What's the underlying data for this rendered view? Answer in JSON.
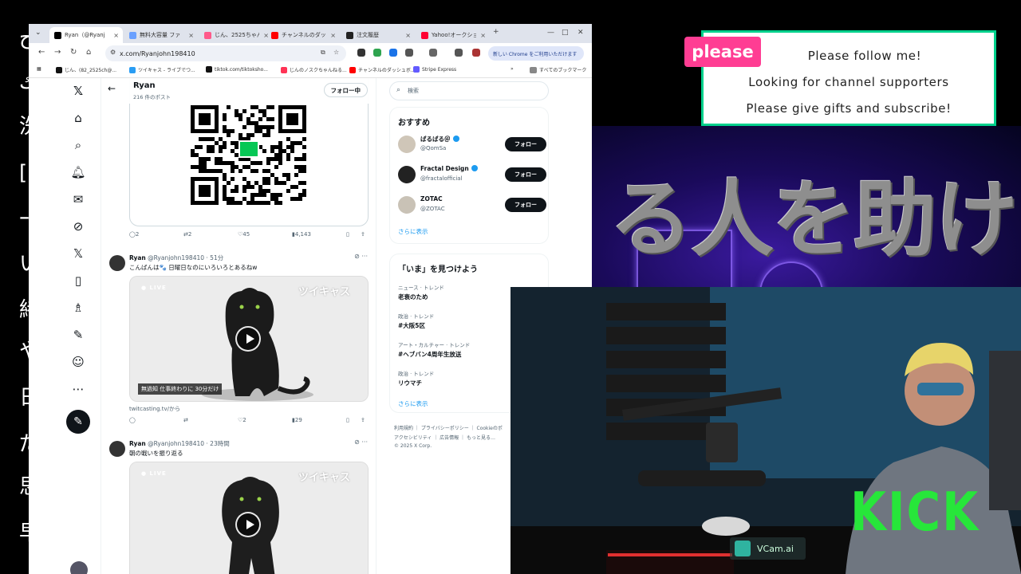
{
  "left_strip": {
    "glyphs": [
      "ح",
      "ك",
      "洗",
      "[",
      "ｰ",
      "い",
      "緒",
      "や",
      "日",
      "だ",
      "思",
      "早"
    ]
  },
  "browser": {
    "tabs": [
      {
        "label": "Ryan（@Ryanj",
        "color": "#000000",
        "active": true
      },
      {
        "label": "無料大容量 ファ",
        "color": "#6aa0ff",
        "active": false
      },
      {
        "label": "じん、2525ちゃん",
        "color": "#ff5a8a",
        "active": false
      },
      {
        "label": "チャンネルのダッシ",
        "color": "#ff0000",
        "active": false
      },
      {
        "label": "注文履歴",
        "color": "#222222",
        "active": false
      },
      {
        "label": "Yahoo!オークショ",
        "color": "#ff0033",
        "active": false
      }
    ],
    "new_tab": "+",
    "window_controls": [
      "—",
      "□",
      "✕"
    ],
    "url": "x.com/Ryanjohn198410",
    "chrome_promo": "新しい Chrome をご利用いただけます",
    "bookmarks": [
      {
        "label": "じん、(82_2525ch@...",
        "color": "#111111"
      },
      {
        "label": "ツイキャス - ライブでつ...",
        "color": "#2a9df4"
      },
      {
        "label": "tiktok.com/tiktoksho...",
        "color": "#111111"
      },
      {
        "label": "じんのノスクちゃんねる...",
        "color": "#ff3355"
      },
      {
        "label": "チャンネルのダッシュボ...",
        "color": "#ff0000"
      },
      {
        "label": "Stripe Express",
        "color": "#635bff"
      }
    ],
    "all_bookmarks": "すべてのブックマーク"
  },
  "profile": {
    "name": "Ryan",
    "post_count": "216 件のポスト",
    "follow_label": "フォロー中"
  },
  "posts": [
    {
      "actions": {
        "reply": "2",
        "repost": "2",
        "like": "45",
        "views": "4,143"
      }
    },
    {
      "author": "Ryan",
      "handle_time": "@Ryanjohn198410 · 51分",
      "text": "こんばんは🐾 日曜日なのにいろいろとあるねw",
      "media_live": "● LIVE",
      "media_brand": "ツイキャス",
      "media_caption": "無過知 仕事終わりに 30分だけ",
      "link": "twitcasting.tv/から",
      "actions": {
        "reply": "",
        "repost": "",
        "like": "2",
        "views": "29"
      }
    },
    {
      "author": "Ryan",
      "handle_time": "@Ryanjohn198410 · 23時間",
      "text": "朝の戦いを振り返る",
      "media_live": "● LIVE",
      "media_brand": "ツイキャス"
    }
  ],
  "search": {
    "placeholder": "検索"
  },
  "recommend": {
    "title": "おすすめ",
    "users": [
      {
        "name": "ぱるぱる＠",
        "handle": "@QomSa",
        "color": "#cfc6b8"
      },
      {
        "name": "Fractal Design",
        "handle": "@fractalofficial",
        "color": "#222222"
      },
      {
        "name": "ZOTAC",
        "handle": "@ZOTAC",
        "color": "#c9c2b6"
      }
    ],
    "follow_label": "フォロー",
    "more": "さらに表示"
  },
  "trends": {
    "title": "「いま」を見つけよう",
    "items": [
      {
        "context": "ニュース · トレンド",
        "name": "老衰のため"
      },
      {
        "context": "政治 · トレンド",
        "name": "#大阪5区"
      },
      {
        "context": "アート・カルチャー · トレンド",
        "name": "#ヘブバン4周年生放送"
      },
      {
        "context": "政治 · トレンド",
        "name": "リウマチ"
      }
    ],
    "more": "さらに表示"
  },
  "footer": {
    "line1": "利用規約 ｜ プライバシーポリシー ｜ Cookieのポ",
    "line2": "アクセシビリティ ｜ 広告情報 ｜ もっと見る…",
    "line3": "© 2025 X Corp."
  },
  "overlay": {
    "please": "please",
    "line1": "Please follow me!",
    "line2": "Looking for channel supporters",
    "line3": "Please give gifts and subscribe!",
    "banner": "る人を助ける",
    "kick": "KICK",
    "vcam": "VCam.ai",
    "accent": "#00d18c",
    "please_color": "#ff3d93",
    "kick_color": "#27e63a"
  }
}
